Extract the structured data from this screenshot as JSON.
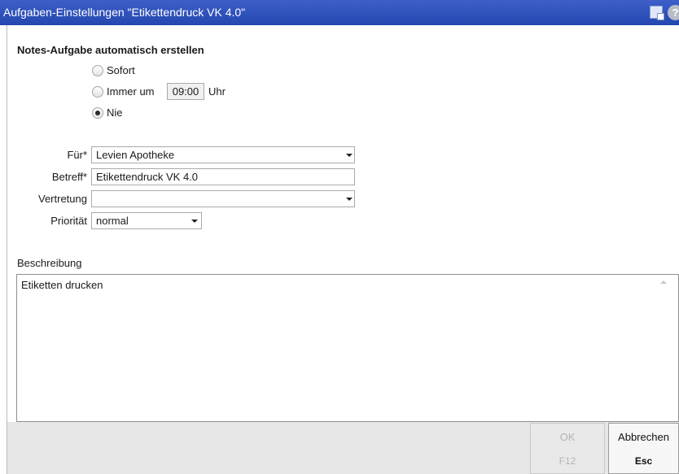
{
  "window": {
    "title": "Aufgaben-Einstellungen \"Etikettendruck VK 4.0\""
  },
  "section": {
    "title": "Notes-Aufgabe automatisch erstellen"
  },
  "schedule": {
    "options": [
      {
        "label": "Sofort",
        "checked": false
      },
      {
        "label": "Immer um",
        "checked": false
      },
      {
        "label": "Nie",
        "checked": true
      }
    ],
    "time_value": "09:00",
    "time_unit": "Uhr"
  },
  "form": {
    "fuer_label": "Für*",
    "fuer_value": "Levien Apotheke",
    "betreff_label": "Betreff*",
    "betreff_value": "Etikettendruck VK 4.0",
    "vertretung_label": "Vertretung",
    "vertretung_value": "",
    "prioritaet_label": "Priorität",
    "prioritaet_value": "normal"
  },
  "description": {
    "label": "Beschreibung",
    "text": "Etiketten drucken"
  },
  "buttons": {
    "ok_label": "OK",
    "ok_key": "F12",
    "cancel_label": "Abbrechen",
    "cancel_key": "Esc"
  },
  "icons": {
    "titlebar": [
      "window-layout-icon",
      "help-icon"
    ]
  },
  "colors": {
    "titlebar": "#2d4fbd",
    "footer": "#e7e7e7"
  }
}
